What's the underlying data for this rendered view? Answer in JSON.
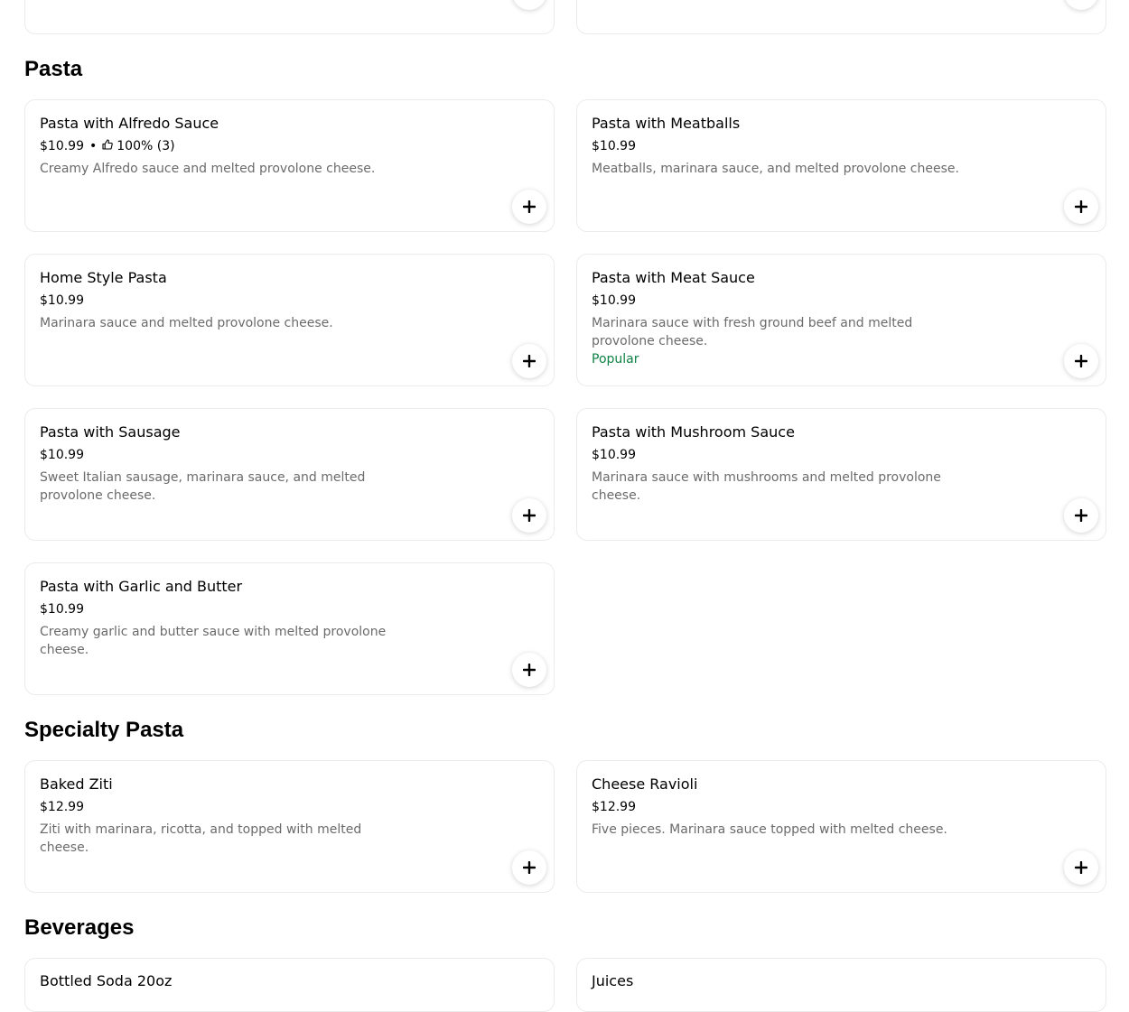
{
  "sections": {
    "pasta": {
      "title": "Pasta",
      "items": [
        {
          "name": "Pasta with Alfredo Sauce",
          "price": "$10.99",
          "rating": "100% (3)",
          "description": "Creamy Alfredo sauce and melted provolone cheese."
        },
        {
          "name": "Pasta with Meatballs",
          "price": "$10.99",
          "description": "Meatballs, marinara sauce, and melted provolone cheese."
        },
        {
          "name": "Home Style Pasta",
          "price": "$10.99",
          "description": "Marinara sauce and melted provolone cheese."
        },
        {
          "name": "Pasta with Meat Sauce",
          "price": "$10.99",
          "description": "Marinara sauce with fresh ground beef and melted provolone cheese.",
          "tag": "Popular"
        },
        {
          "name": "Pasta with Sausage",
          "price": "$10.99",
          "description": "Sweet Italian sausage, marinara sauce, and melted provolone cheese."
        },
        {
          "name": "Pasta with Mushroom Sauce",
          "price": "$10.99",
          "description": "Marinara sauce with mushrooms and melted provolone cheese."
        },
        {
          "name": "Pasta with Garlic and Butter",
          "price": "$10.99",
          "description": "Creamy garlic and butter sauce with melted provolone cheese."
        }
      ]
    },
    "specialty": {
      "title": "Specialty Pasta",
      "items": [
        {
          "name": "Baked Ziti",
          "price": "$12.99",
          "description": "Ziti with marinara, ricotta, and topped with melted cheese."
        },
        {
          "name": "Cheese Ravioli",
          "price": "$12.99",
          "description": "Five pieces. Marinara sauce topped with melted cheese."
        }
      ]
    },
    "beverages": {
      "title": "Beverages",
      "items": [
        {
          "name": "Bottled Soda 20oz"
        },
        {
          "name": "Juices"
        }
      ]
    }
  },
  "meta_separator": "•",
  "icons": {
    "add": "plus-icon",
    "rating": "thumbs-up-icon"
  },
  "colors": {
    "tag": "#0e8345",
    "description": "#6b6b6b",
    "border": "#ebebeb"
  }
}
